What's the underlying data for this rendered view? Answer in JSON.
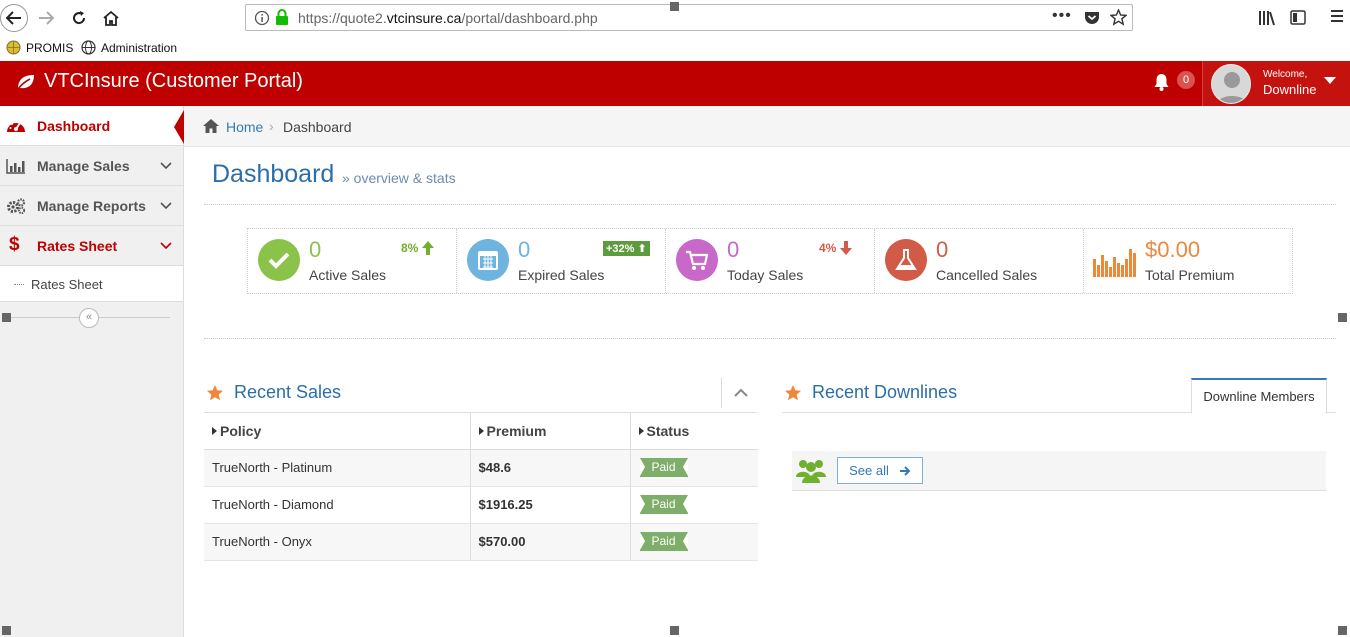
{
  "browser": {
    "url_prefix": "https://quote2.",
    "url_domain": "vtcinsure.ca",
    "url_path": "/portal/dashboard.php",
    "bookmarks": [
      "PROMIS",
      "Administration"
    ]
  },
  "header": {
    "brand": "VTCInsure (Customer Portal)",
    "notification_count": "0",
    "welcome": "Welcome,",
    "user_name": "Downline"
  },
  "sidebar": {
    "items": [
      {
        "label": "Dashboard",
        "active": true
      },
      {
        "label": "Manage Sales"
      },
      {
        "label": "Manage Reports"
      },
      {
        "label": "Rates Sheet"
      }
    ],
    "sub_items": [
      "Rates Sheet"
    ]
  },
  "breadcrumb": {
    "home": "Home",
    "separator": "›",
    "current": "Dashboard"
  },
  "page": {
    "title": "Dashboard",
    "subtitle": "» overview & stats"
  },
  "stats": [
    {
      "value": "0",
      "label": "Active Sales",
      "trend": "8%",
      "trend_dir": "up",
      "color": "#8bc34a"
    },
    {
      "value": "0",
      "label": "Expired Sales",
      "trend": "+32%",
      "trend_dir": "up",
      "color": "#6fb3e0"
    },
    {
      "value": "0",
      "label": "Today Sales",
      "trend": "4%",
      "trend_dir": "down",
      "color": "#c868c8"
    },
    {
      "value": "0",
      "label": "Cancelled Sales",
      "color": "#d15b47"
    },
    {
      "value": "$0.00",
      "label": "Total Premium",
      "color": "#f0883a"
    }
  ],
  "recent_sales": {
    "title": "Recent Sales",
    "columns": [
      "Policy",
      "Premium",
      "Status"
    ],
    "rows": [
      {
        "policy": "TrueNorth - Platinum",
        "premium": "$48.6",
        "status": "Paid"
      },
      {
        "policy": "TrueNorth - Diamond",
        "premium": "$1916.25",
        "status": "Paid"
      },
      {
        "policy": "TrueNorth - Onyx",
        "premium": "$570.00",
        "status": "Paid"
      }
    ]
  },
  "recent_downlines": {
    "title": "Recent Downlines",
    "tab": "Downline Members",
    "see_all": "See all"
  }
}
